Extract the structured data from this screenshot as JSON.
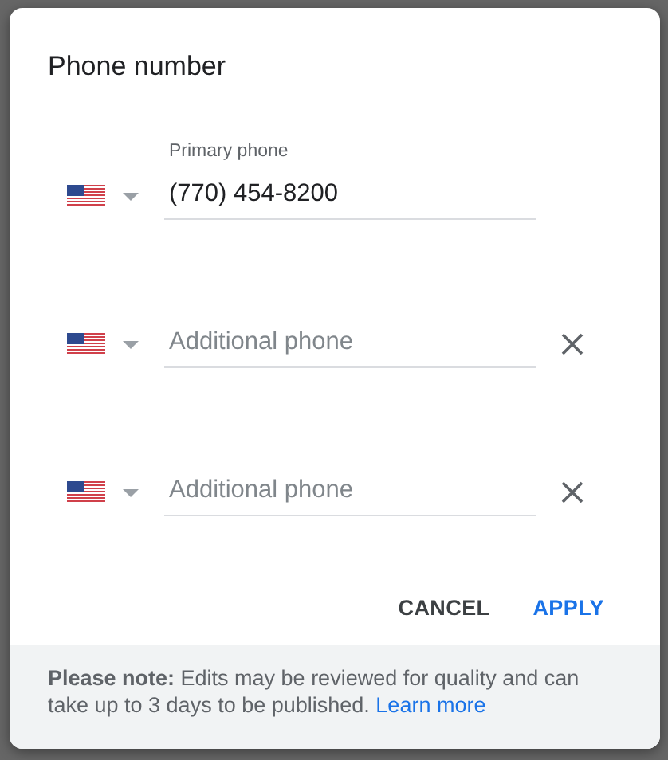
{
  "dialog": {
    "title": "Phone number",
    "phones": [
      {
        "label": "Primary phone",
        "value": "(770) 454-8200",
        "removable": false
      },
      {
        "placeholder": "Additional phone",
        "removable": true
      },
      {
        "placeholder": "Additional phone",
        "removable": true
      }
    ],
    "buttons": [
      {
        "label": "CANCEL",
        "kind": "text"
      },
      {
        "label": "APPLY",
        "kind": "primary"
      }
    ],
    "note": {
      "text": "**Please note:** Edits may be reviewed for quality and can take up to 3 days to be published.",
      "link": "Learn more"
    }
  }
}
